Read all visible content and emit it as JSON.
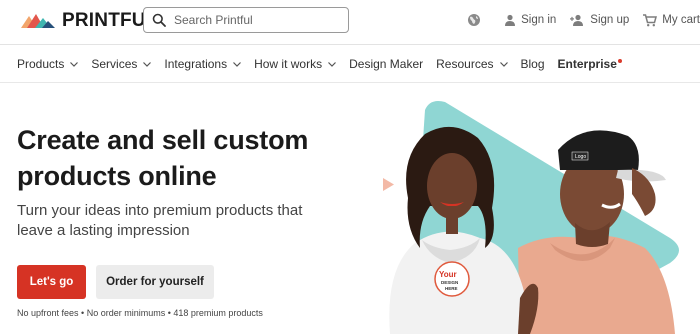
{
  "brand": {
    "name": "PRINTFUL"
  },
  "search": {
    "placeholder": "Search Printful"
  },
  "header": {
    "sign_in": "Sign in",
    "sign_up": "Sign up",
    "cart": "My cart"
  },
  "nav": {
    "items": [
      {
        "label": "Products",
        "dropdown": true
      },
      {
        "label": "Services",
        "dropdown": true
      },
      {
        "label": "Integrations",
        "dropdown": true
      },
      {
        "label": "How it works",
        "dropdown": true
      },
      {
        "label": "Design Maker",
        "dropdown": false
      },
      {
        "label": "Resources",
        "dropdown": true
      },
      {
        "label": "Blog",
        "dropdown": false
      },
      {
        "label": "Enterprise",
        "dropdown": false
      }
    ]
  },
  "hero": {
    "title": "Create and sell custom products online",
    "subtitle": "Turn your ideas into premium products that leave a lasting impression",
    "primary_cta": "Let's go",
    "secondary_cta": "Order for yourself",
    "fine_print": "No upfront fees • No order minimums • 418 premium products"
  },
  "art": {
    "hoodie_text_1": "Your",
    "hoodie_text_2": "DESIGN",
    "hoodie_text_3": "HERE",
    "cap_text": "Logo"
  },
  "colors": {
    "accent": "#d63324",
    "teal": "#8fd6d3",
    "peach": "#f3b9a6"
  }
}
